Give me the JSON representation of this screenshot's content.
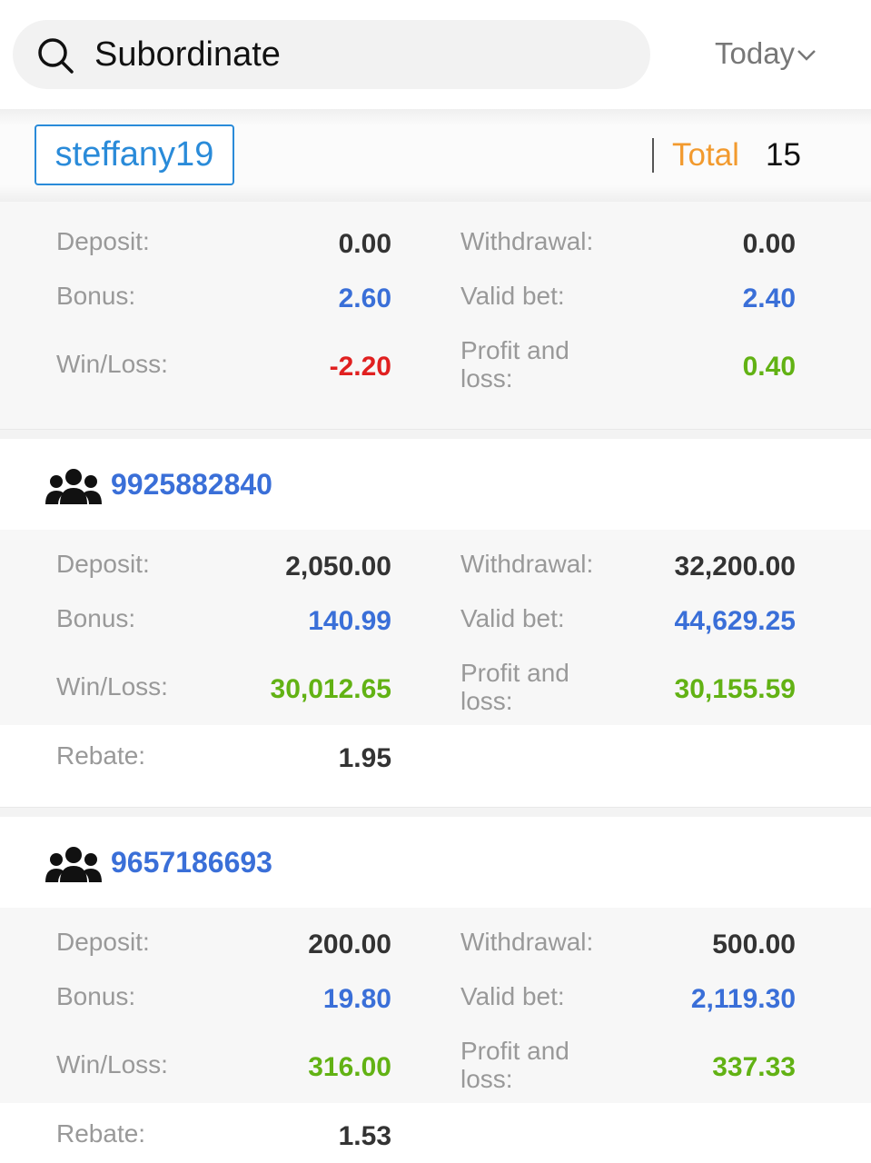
{
  "header": {
    "search_text": "Subordinate",
    "filter_label": "Today"
  },
  "userbar": {
    "username": "steffany19",
    "total_label": "Total",
    "total_value": "15"
  },
  "summary": {
    "deposit_label": "Deposit:",
    "deposit": "0.00",
    "withdrawal_label": "Withdrawal:",
    "withdrawal": "0.00",
    "bonus_label": "Bonus:",
    "bonus": "2.60",
    "valid_bet_label": "Valid bet:",
    "valid_bet": "2.40",
    "winloss_label": "Win/Loss:",
    "winloss": "-2.20",
    "pnl_label_1": "Profit and",
    "pnl_label_2": "loss:",
    "pnl": "0.40"
  },
  "subordinates": [
    {
      "id": "9925882840",
      "deposit_label": "Deposit:",
      "deposit": "2,050.00",
      "withdrawal_label": "Withdrawal:",
      "withdrawal": "32,200.00",
      "bonus_label": "Bonus:",
      "bonus": "140.99",
      "valid_bet_label": "Valid bet:",
      "valid_bet": "44,629.25",
      "winloss_label": "Win/Loss:",
      "winloss": "30,012.65",
      "pnl_label_1": "Profit and",
      "pnl_label_2": "loss:",
      "pnl": "30,155.59",
      "rebate_label": "Rebate:",
      "rebate": "1.95"
    },
    {
      "id": "9657186693",
      "deposit_label": "Deposit:",
      "deposit": "200.00",
      "withdrawal_label": "Withdrawal:",
      "withdrawal": "500.00",
      "bonus_label": "Bonus:",
      "bonus": "19.80",
      "valid_bet_label": "Valid bet:",
      "valid_bet": "2,119.30",
      "winloss_label": "Win/Loss:",
      "winloss": "316.00",
      "pnl_label_1": "Profit and",
      "pnl_label_2": "loss:",
      "pnl": "337.33",
      "rebate_label": "Rebate:",
      "rebate": "1.53"
    }
  ],
  "colors": {
    "accent_blue": "#3a6fd8",
    "username_blue": "#2a8bd9",
    "total_orange": "#f29a2e",
    "loss_red": "#e02020",
    "gain_green": "#62b214"
  },
  "icons": {
    "search": "search-icon",
    "dropdown": "chevron-down-icon",
    "member": "group-icon"
  }
}
